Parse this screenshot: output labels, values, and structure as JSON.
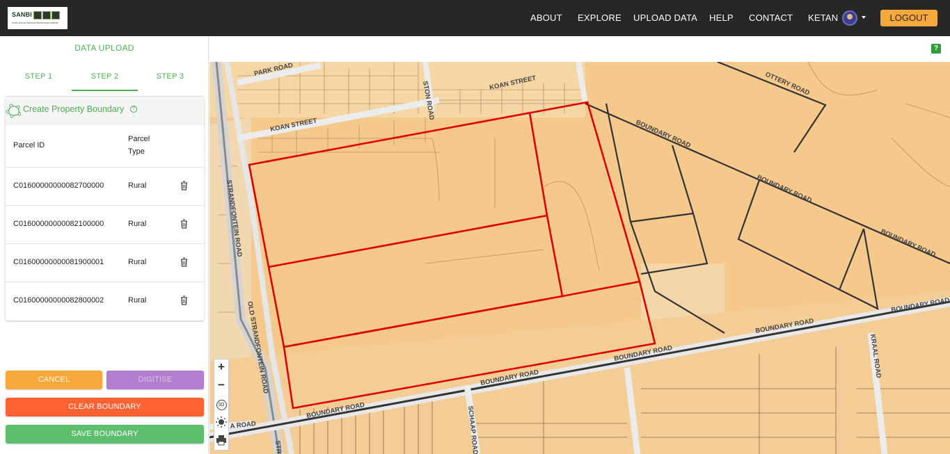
{
  "header": {
    "logo_text": "SANBI",
    "logo_tagline": "South African National Biodiversity Institute",
    "nav": [
      "ABOUT",
      "EXPLORE",
      "UPLOAD DATA",
      "HELP",
      "CONTACT"
    ],
    "user": "KETAN",
    "logout_label": "LOGOUT"
  },
  "sidebar": {
    "title": "DATA UPLOAD",
    "tabs": [
      "STEP 1",
      "STEP 2",
      "STEP 3"
    ],
    "active_tab": "STEP 2",
    "section_label": "Create Property Boundary",
    "help_glyph": "?",
    "table": {
      "headers": [
        "Parcel ID",
        "Parcel Type"
      ],
      "header_type_lines": [
        "Parcel",
        "Type"
      ],
      "rows": [
        {
          "id": "C01600000000082700000",
          "type": "Rural"
        },
        {
          "id": "C01600000000082100000",
          "type": "Rural"
        },
        {
          "id": "C01600000000081900001",
          "type": "Rural"
        },
        {
          "id": "C01600000000082800002",
          "type": "Rural"
        }
      ]
    },
    "buttons": {
      "cancel": "CANCEL",
      "digitise": "DIGITISE",
      "clear": "CLEAR BOUNDARY",
      "save": "SAVE BOUNDARY"
    }
  },
  "map": {
    "help_glyph": "?",
    "labels": {
      "park": "PARK ROAD",
      "ston": "STON ROAD",
      "koan1": "KOAN STREET",
      "koan2": "KOAN STREET",
      "ottery": "OTTERY ROAD",
      "boundary1": "BOUNDARY ROAD",
      "boundary2": "BOUNDARY ROAD",
      "boundary3": "BOUNDARY ROAD",
      "boundary4": "BOUNDARY ROAD",
      "boundary5": "BOUNDARY ROAD",
      "boundary6": "BOUNDARY ROAD",
      "boundary7": "BOUNDARY ROAD",
      "boundary8": "BOUNDARY ROAD",
      "strandfontein": "STRANDFONTEIN ROAD",
      "old_strandfontein": "OLD STRANDFONTEIN ROAD",
      "schaap": "SCHAAP ROAD",
      "kraal": "KRAAL ROAD",
      "a_road": "A ROAD",
      "str": "STR"
    },
    "controls": {
      "zoom_in": "+",
      "zoom_out": "−",
      "view_3d": "3D"
    },
    "colors": {
      "land": "#f5c88c",
      "selected_boundary": "#e00000",
      "road": "#ececec"
    }
  },
  "colors": {
    "green": "#4caf50",
    "orange": "#f7a83b",
    "purple": "#b27fd0",
    "red_orange": "#ff6333",
    "save_green": "#5dbf6e",
    "topbar": "#272727"
  }
}
